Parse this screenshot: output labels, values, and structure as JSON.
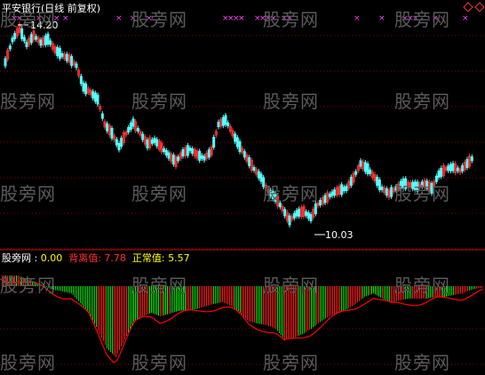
{
  "title": "平安银行(日线 前复权)",
  "price_high_label": "14.20",
  "price_low_label": "10.03",
  "indicator": {
    "name": "股旁网",
    "value0": "0.00",
    "label1": "背离值",
    "value1": "7.78",
    "label2": "正常值",
    "value2": "5.57"
  },
  "watermark": "股旁网",
  "colors": {
    "background": "#000000",
    "up_candle": "#ff3030",
    "down_candle": "#54ffff",
    "grid": "#8b0000",
    "signal": "#ff40ff",
    "bar_up": "#ff2020",
    "bar_down": "#00e000",
    "bar_strong": "#00ff00",
    "line": "#ff0000",
    "text_white": "#ffffff",
    "text_yellow": "#ffff00",
    "text_red": "#ff3030"
  },
  "icons": [
    "diamond-icon",
    "diamond-icon"
  ]
}
